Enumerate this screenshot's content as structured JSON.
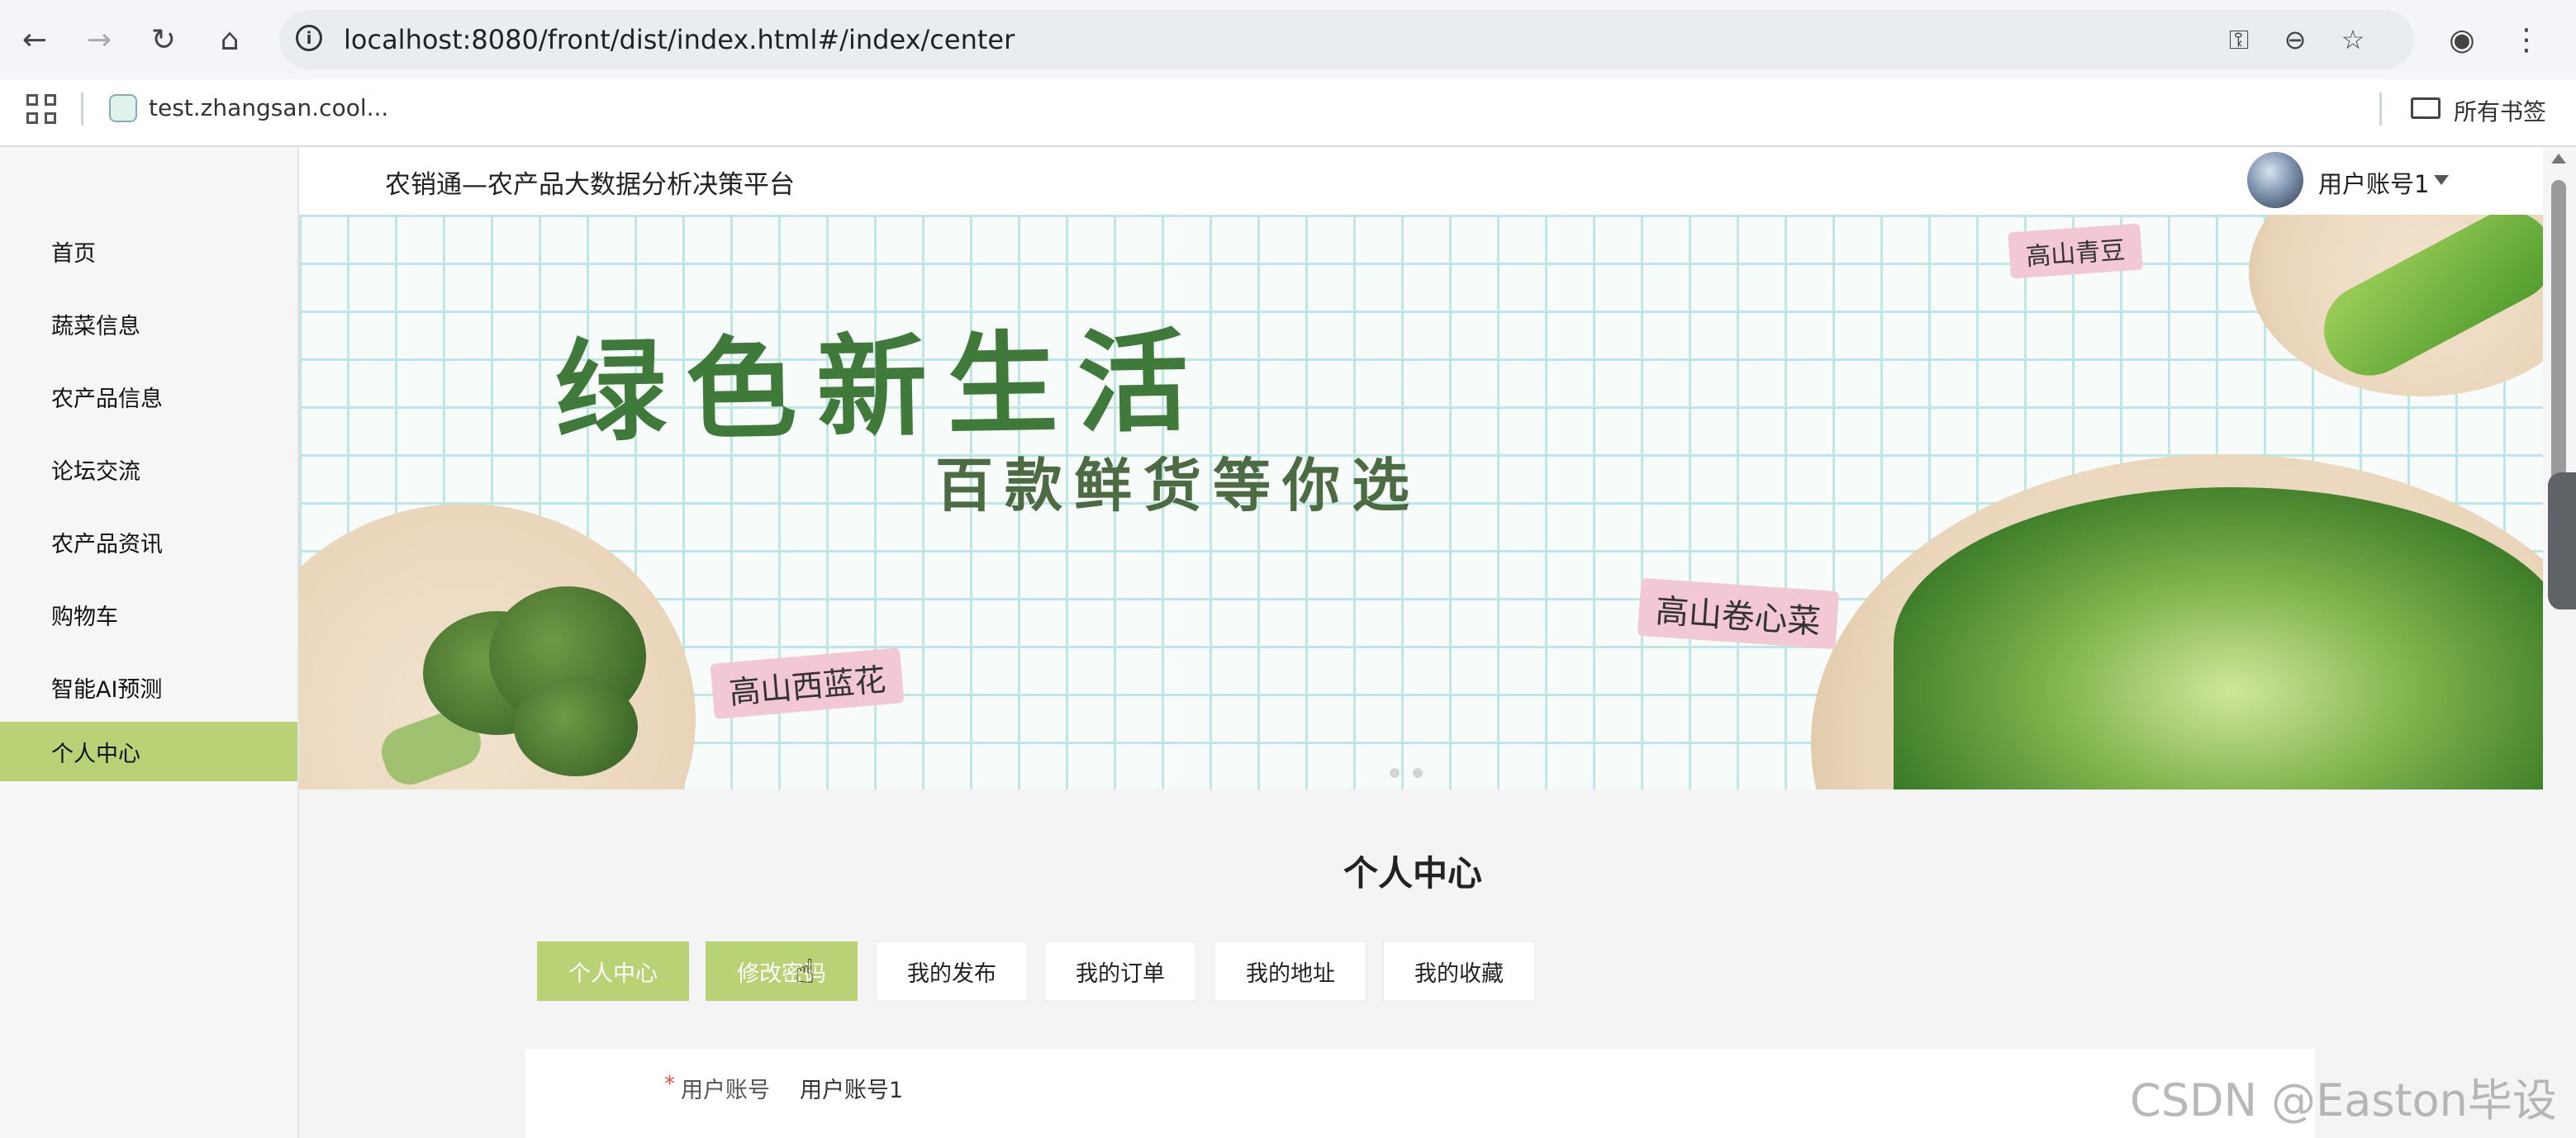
{
  "browser": {
    "url": "localhost:8080/front/dist/index.html#/index/center",
    "bookmark_label": "test.zhangsan.cool...",
    "all_bookmarks_label": "所有书签"
  },
  "app": {
    "title": "农销通—农产品大数据分析决策平台",
    "user_name": "用户账号1"
  },
  "sidebar": {
    "items": [
      {
        "label": "首页"
      },
      {
        "label": "蔬菜信息"
      },
      {
        "label": "农产品信息"
      },
      {
        "label": "论坛交流"
      },
      {
        "label": "农产品资讯"
      },
      {
        "label": "购物车"
      },
      {
        "label": "智能AI预测"
      },
      {
        "label": "个人中心"
      }
    ],
    "active_index": 7
  },
  "banner": {
    "headline": "绿色新生活",
    "subline": "百款鲜货等你选",
    "tags": [
      "高山青豆",
      "高山西蓝花",
      "高山卷心菜"
    ],
    "carousel_dots": 2
  },
  "center": {
    "title": "个人中心",
    "tabs": [
      {
        "label": "个人中心"
      },
      {
        "label": "修改密码"
      },
      {
        "label": "我的发布"
      },
      {
        "label": "我的订单"
      },
      {
        "label": "我的地址"
      },
      {
        "label": "我的收藏"
      }
    ],
    "form": {
      "required_mark": "*",
      "account_label": "用户账号",
      "account_value": "用户账号1"
    }
  },
  "watermark": "CSDN @Easton毕设",
  "colors": {
    "accent": "#b9d275",
    "page_bg": "#f4f4f4",
    "headline_green": "#3f7a3a",
    "required": "#e74c3c"
  },
  "icons": {
    "back": "arrow-left-icon",
    "forward": "arrow-right-icon",
    "reload": "reload-icon",
    "home": "home-icon",
    "site_info": "info-icon",
    "password_key": "key-icon",
    "zoom": "zoom-icon",
    "star": "star-icon",
    "profile": "profile-icon",
    "menu": "kebab-menu-icon",
    "apps": "apps-grid-icon",
    "folder": "folder-icon"
  }
}
